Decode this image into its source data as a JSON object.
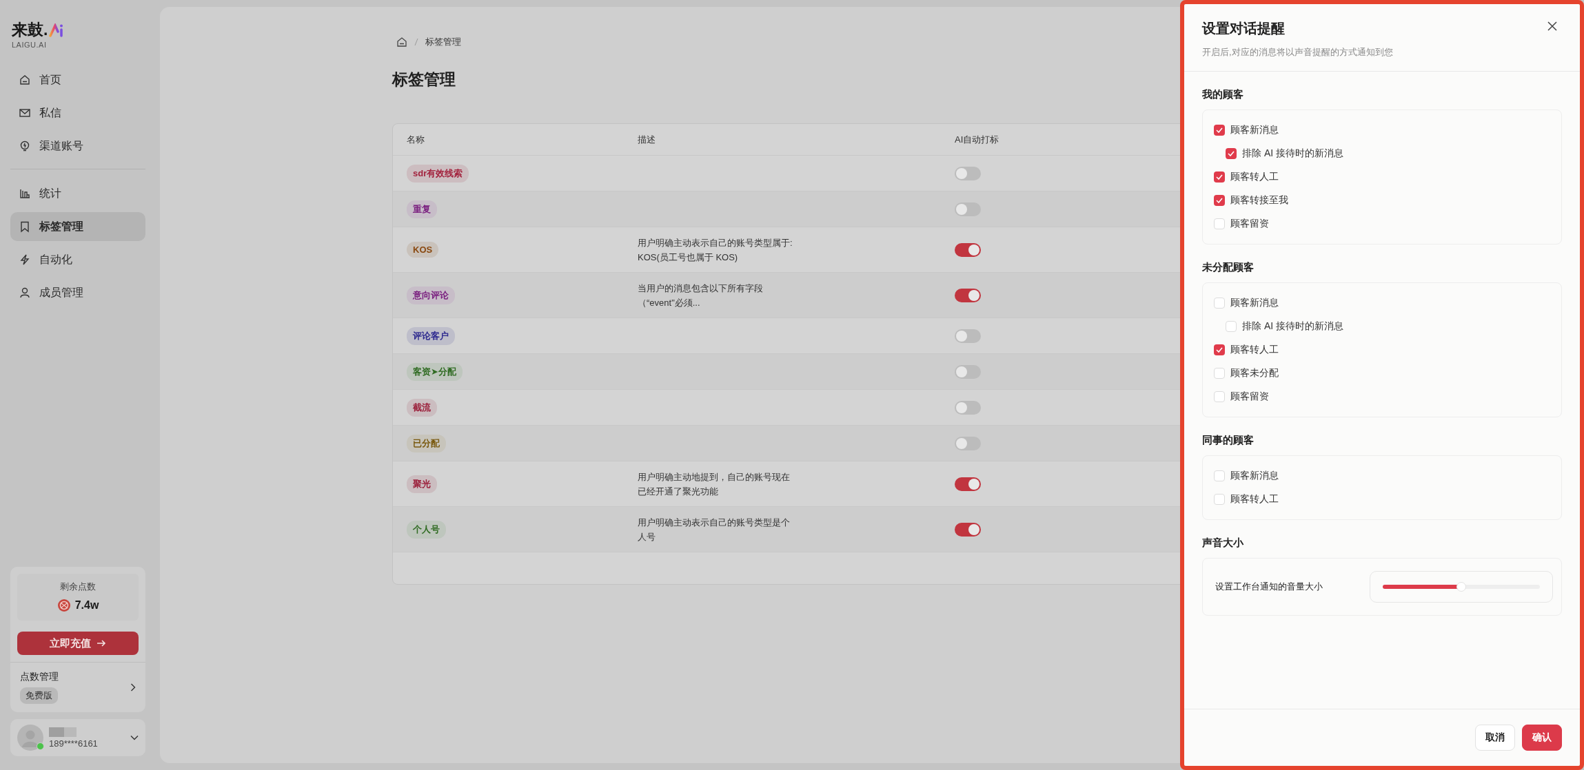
{
  "sidebar": {
    "logo_text": "来鼓.",
    "logo_sub": "LAIGU.AI",
    "nav_groups": [
      [
        {
          "label": "首页",
          "selected": false
        },
        {
          "label": "私信",
          "selected": false
        },
        {
          "label": "渠道账号",
          "selected": false
        }
      ],
      [
        {
          "label": "统计",
          "selected": false
        },
        {
          "label": "标签管理",
          "selected": true
        },
        {
          "label": "自动化",
          "selected": false
        },
        {
          "label": "成员管理",
          "selected": false
        }
      ]
    ],
    "points": {
      "title": "剩余点数",
      "value": "7.4w",
      "recharge": "立即充值",
      "manage": "点数管理",
      "plan": "免费版"
    },
    "user": {
      "phone": "189****6161"
    }
  },
  "main": {
    "breadcrumb": "标签管理",
    "title": "标签管理",
    "table": {
      "columns": [
        "名称",
        "描述",
        "AI自动打标"
      ],
      "rows": [
        {
          "name": "sdr有效线索",
          "color": "#a3243f",
          "description": "",
          "ai_auto": false
        },
        {
          "name": "重复",
          "color": "#7a1f7f",
          "description": "",
          "ai_auto": false
        },
        {
          "name": "KOS",
          "color": "#8a4a12",
          "description": "用户明确主动表示自己的账号类型属于: KOS(员工号也属于 KOS)",
          "ai_auto": true
        },
        {
          "name": "意向评论",
          "color": "#7a1f7f",
          "description": "当用户的消息包含以下所有字段（“event\"必须...",
          "ai_auto": true
        },
        {
          "name": "评论客户",
          "color": "#2e2a8f",
          "description": "",
          "ai_auto": false
        },
        {
          "name": "客资➤分配",
          "color": "#2f6b22",
          "description": "",
          "ai_auto": false
        },
        {
          "name": "截流",
          "color": "#9b1f3a",
          "description": "",
          "ai_auto": false
        },
        {
          "name": "已分配",
          "color": "#7a5a10",
          "description": "",
          "ai_auto": false
        },
        {
          "name": "聚光",
          "color": "#9b1f3a",
          "description": "用户明确主动地提到，自己的账号现在已经开通了聚光功能",
          "ai_auto": true
        },
        {
          "name": "个人号",
          "color": "#2f6b22",
          "description": "用户明确主动表示自己的账号类型是个人号",
          "ai_auto": true
        }
      ]
    }
  },
  "drawer": {
    "title": "设置对话提醒",
    "subtitle": "开启后,对应的消息将以声音提醒的方式通知到您",
    "sections": [
      {
        "title": "我的顾客",
        "kind": "checkboxes",
        "options": [
          {
            "label": "顾客新消息",
            "checked": true,
            "children": [
              {
                "label": "排除 AI 接待时的新消息",
                "checked": true
              }
            ]
          },
          {
            "label": "顾客转人工",
            "checked": true
          },
          {
            "label": "顾客转接至我",
            "checked": true
          },
          {
            "label": "顾客留资",
            "checked": false
          }
        ]
      },
      {
        "title": "未分配顾客",
        "kind": "checkboxes",
        "options": [
          {
            "label": "顾客新消息",
            "checked": false,
            "children": [
              {
                "label": "排除 AI 接待时的新消息",
                "checked": false
              }
            ]
          },
          {
            "label": "顾客转人工",
            "checked": true
          },
          {
            "label": "顾客未分配",
            "checked": false
          },
          {
            "label": "顾客留资",
            "checked": false
          }
        ]
      },
      {
        "title": "同事的顾客",
        "kind": "checkboxes",
        "options": [
          {
            "label": "顾客新消息",
            "checked": false
          },
          {
            "label": "顾客转人工",
            "checked": false
          }
        ]
      },
      {
        "title": "声音大小",
        "kind": "slider",
        "label": "设置工作台通知的音量大小",
        "level": 0.5
      }
    ],
    "buttons": [
      {
        "label": "取消",
        "primary": false
      },
      {
        "label": "确认",
        "primary": true
      }
    ]
  }
}
